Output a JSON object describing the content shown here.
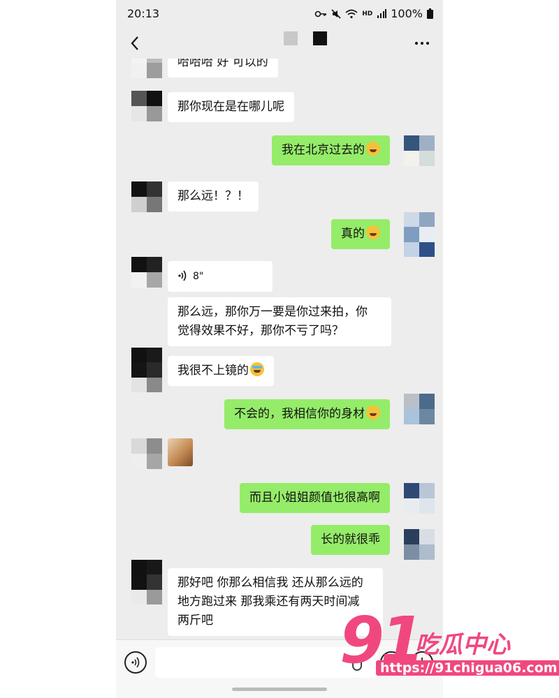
{
  "status": {
    "time": "20:13",
    "battery": "100%",
    "network": "HD"
  },
  "header": {
    "back_icon": "chevron-left-icon",
    "more_icon": "more-dots-icon"
  },
  "messages": [
    {
      "side": "in",
      "text": "哈哈哈 好 可以的"
    },
    {
      "side": "in",
      "text": "那你现在是在哪儿呢"
    },
    {
      "side": "out",
      "text": "我在北京过去的",
      "emoji": "laugh-cry"
    },
    {
      "side": "in",
      "text": "那么远！？！"
    },
    {
      "side": "out",
      "text": "真的",
      "emoji": "laugh-cry"
    },
    {
      "side": "in",
      "type": "voice",
      "duration": "8\""
    },
    {
      "side": "in",
      "lines": [
        "那么远，那你万一要是你过来拍，你",
        "觉得效果不好，那你不亏了吗？"
      ]
    },
    {
      "side": "in",
      "text": "我很不上镜的",
      "emoji": "crying"
    },
    {
      "side": "out",
      "text": "不会的，我相信你的身材",
      "emoji": "laugh-cry"
    },
    {
      "side": "in",
      "type": "image"
    },
    {
      "side": "out",
      "text": "而且小姐姐颜值也很高啊"
    },
    {
      "side": "out",
      "text": "长的就很乖"
    },
    {
      "side": "in",
      "lines": [
        "那好吧 你那么相信我 还从那么远的",
        "地方跑过来 那我乘还有两天时间减",
        "两斤吧"
      ]
    }
  ],
  "watermark": {
    "number": "91",
    "name": "吃瓜中心",
    "url": "https://91chigua06.com"
  },
  "colors": {
    "incoming": "#ffffff",
    "outgoing": "#95ec69",
    "background": "#ededed",
    "watermark": "#f0487e"
  }
}
